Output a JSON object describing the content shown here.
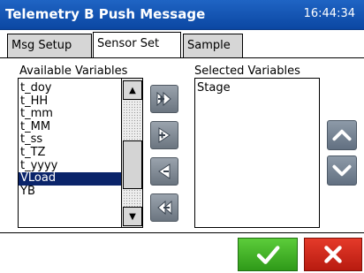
{
  "window": {
    "title": "Telemetry B Push Message",
    "clock": "16:44:34"
  },
  "tabs": [
    {
      "label": "Msg Setup",
      "active": false
    },
    {
      "label": "Sensor Set",
      "active": true
    },
    {
      "label": "Sample",
      "active": false
    }
  ],
  "available": {
    "label": "Available Variables",
    "items": [
      "t_doy",
      "t_HH",
      "t_mm",
      "t_MM",
      "t_ss",
      "t_TZ",
      "t_yyyy",
      "VLoad",
      "YB"
    ],
    "selected_item": "VLoad"
  },
  "selected": {
    "label": "Selected Variables",
    "items": [
      "Stage"
    ]
  },
  "move_buttons": [
    "add-all-icon",
    "add-icon",
    "remove-icon",
    "remove-all-icon"
  ],
  "order_buttons": [
    "move-up-icon",
    "move-down-icon"
  ],
  "footer": {
    "ok_icon": "checkmark-icon",
    "cancel_icon": "close-icon"
  },
  "colors": {
    "titlebar": "#0b47a3",
    "selection": "#0a246a",
    "ok": "#3aa81f",
    "cancel": "#d1271a"
  }
}
